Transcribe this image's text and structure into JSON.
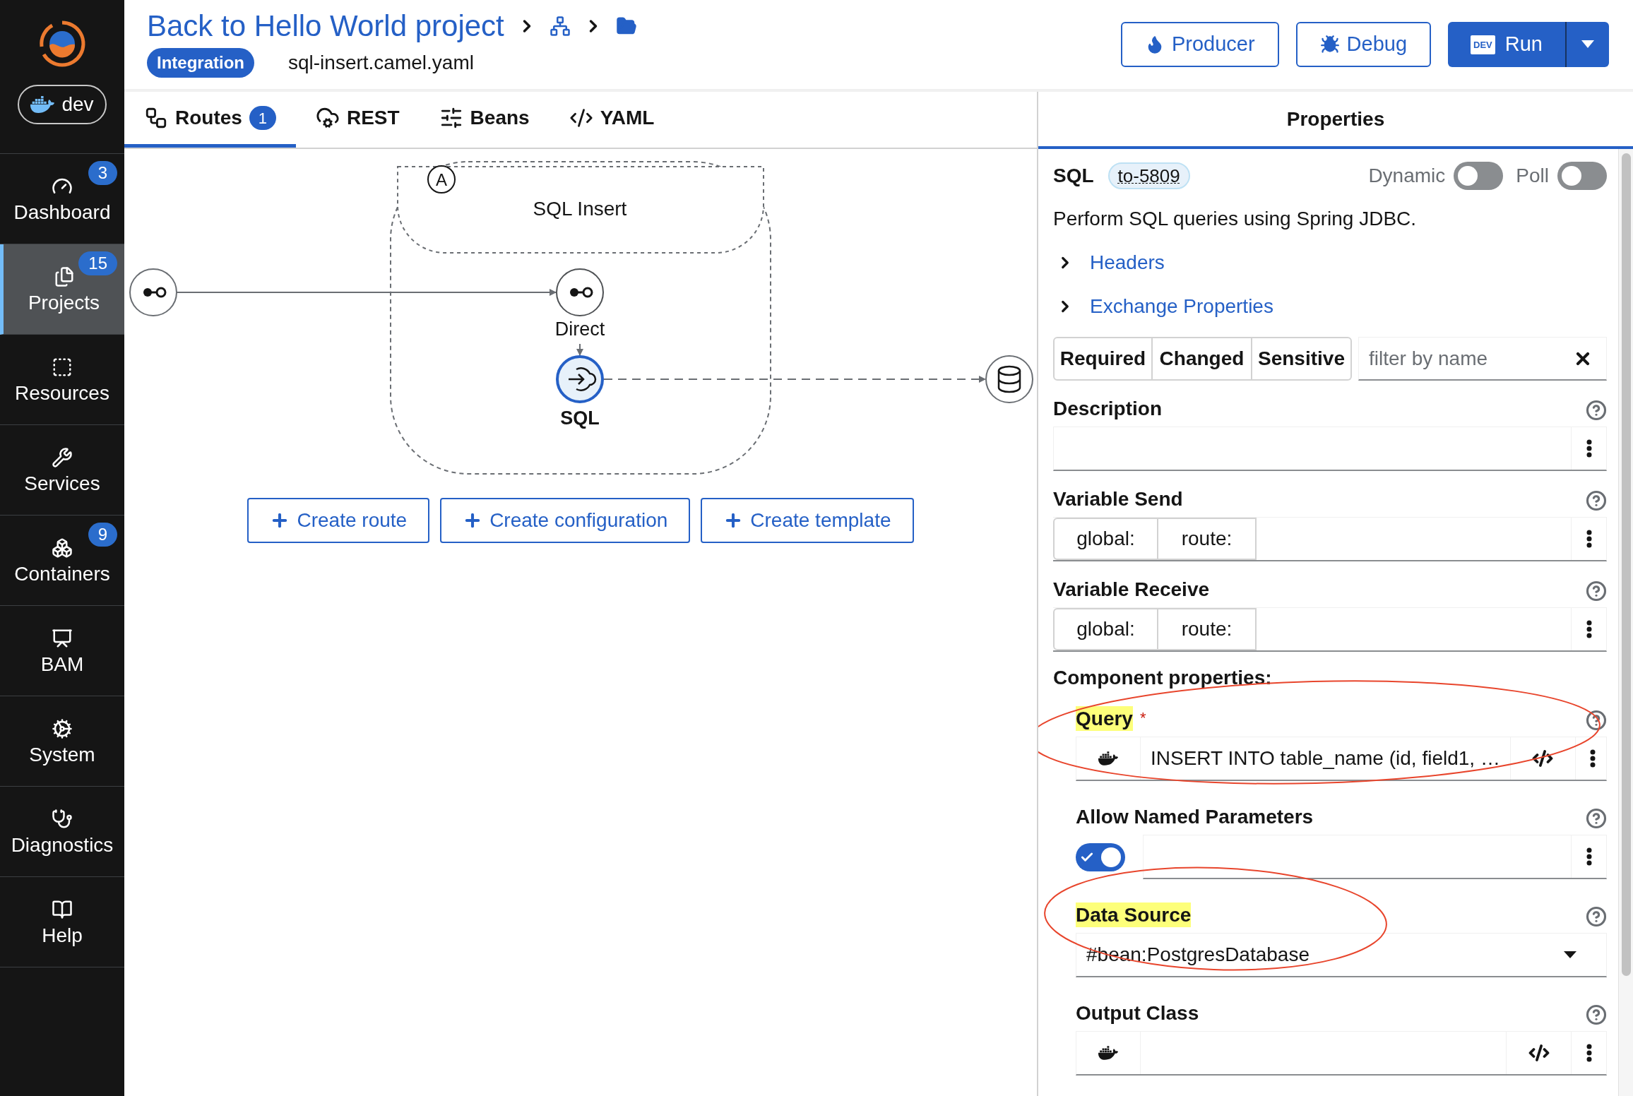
{
  "sidebar": {
    "env": "dev",
    "items": [
      {
        "label": "Dashboard",
        "badge": "3",
        "selected": false
      },
      {
        "label": "Projects",
        "badge": "15",
        "selected": true
      },
      {
        "label": "Resources",
        "selected": false
      },
      {
        "label": "Services",
        "selected": false
      },
      {
        "label": "Containers",
        "badge": "9",
        "selected": false
      },
      {
        "label": "BAM",
        "selected": false
      },
      {
        "label": "System",
        "selected": false
      },
      {
        "label": "Diagnostics",
        "selected": false
      },
      {
        "label": "Help",
        "selected": false
      }
    ]
  },
  "header": {
    "back_link": "Back to Hello World project",
    "tag": "Integration",
    "file": "sql-insert.camel.yaml",
    "buttons": [
      {
        "label": "Producer",
        "kind": "outline"
      },
      {
        "label": "Debug",
        "kind": "outline"
      },
      {
        "label": "Run",
        "kind": "primary",
        "badge": "DEV"
      }
    ]
  },
  "tabs": [
    {
      "label": "Routes",
      "badge": "1",
      "selected": true
    },
    {
      "label": "REST",
      "selected": false
    },
    {
      "label": "Beans",
      "selected": false
    },
    {
      "label": "YAML",
      "selected": false
    }
  ],
  "diagram": {
    "group_title": "SQL Insert",
    "group_marker": "A",
    "nodes": [
      {
        "label": "Direct",
        "selected": false
      },
      {
        "label": "SQL",
        "selected": true
      }
    ]
  },
  "canvas_buttons": [
    "Create route",
    "Create configuration",
    "Create template"
  ],
  "properties": {
    "title": "Properties",
    "component": "SQL",
    "id": "to-5809",
    "switches": [
      {
        "label": "Dynamic",
        "on": false
      },
      {
        "label": "Poll",
        "on": false
      }
    ],
    "description": "Perform SQL queries using Spring JDBC.",
    "sections": [
      {
        "label": "Headers",
        "expanded": false
      },
      {
        "label": "Exchange Properties",
        "expanded": false
      }
    ],
    "filters": [
      {
        "label": "Required",
        "selected": false
      },
      {
        "label": "Changed",
        "selected": false
      },
      {
        "label": "Sensitive",
        "selected": false
      }
    ],
    "filter_placeholder": "filter by name",
    "fields": [
      {
        "kind": "text",
        "label": "Description"
      },
      {
        "kind": "variable",
        "label": "Variable Send",
        "prefixes": [
          "global:",
          "route:"
        ]
      },
      {
        "kind": "variable",
        "label": "Variable Receive",
        "prefixes": [
          "global:",
          "route:"
        ]
      }
    ],
    "component_heading": "Component properties:",
    "component_fields": [
      {
        "kind": "expression",
        "label": "Query",
        "required_mark": "*",
        "highlighted": true,
        "circled": true,
        "value": "INSERT INTO table_name (id, field1, …"
      },
      {
        "kind": "toggle",
        "label": "Allow Named Parameters",
        "on": true
      },
      {
        "kind": "select",
        "label": "Data Source",
        "highlighted": true,
        "circled": true,
        "value": "#bean:PostgresDatabase"
      },
      {
        "kind": "expression",
        "label": "Output Class"
      }
    ]
  }
}
